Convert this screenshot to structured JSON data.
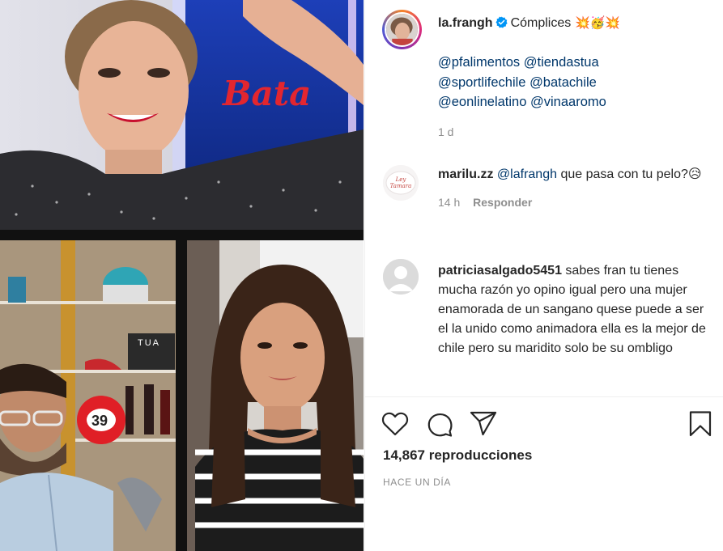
{
  "post": {
    "author": "la.frangh",
    "caption_text": "Cómplices",
    "caption_emojis": "💥🥳💥",
    "mentions": [
      "@pfalimentos",
      "@tiendastua",
      "@sportlifechile",
      "@batachile",
      "@eonlinelatino",
      "@vinaaromo"
    ],
    "caption_time": "1 d"
  },
  "media": {
    "brand_text": "Bata",
    "shelf_label": "TUA",
    "mascot_number": "39"
  },
  "comments": [
    {
      "username": "marilu.zz",
      "mention": "@lafrangh",
      "text": "que pasa con tu pelo?😥",
      "time": "14 h",
      "reply_label": "Responder",
      "avatar_text": "Ley Tamara"
    },
    {
      "username": "patriciasalgado5451",
      "text": "sabes fran tu tienes mucha razón yo opino igual pero una mujer enamorada de un sangano quese puede a ser el la unido como animadora ella es la mejor de chile pero su maridito solo be su ombligo"
    }
  ],
  "stats": {
    "views_count": "14,867",
    "views_label": "reproducciones",
    "posted_label": "HACE UN DÍA"
  },
  "icons": {
    "like": "heart-icon",
    "comment": "comment-icon",
    "share": "paper-plane-icon",
    "save": "bookmark-icon",
    "verified": "verified-badge-icon"
  },
  "colors": {
    "text": "#262626",
    "muted": "#8e8e8e",
    "mention": "#00376b",
    "verified": "#0095f6",
    "brand_red": "#e3262f"
  }
}
